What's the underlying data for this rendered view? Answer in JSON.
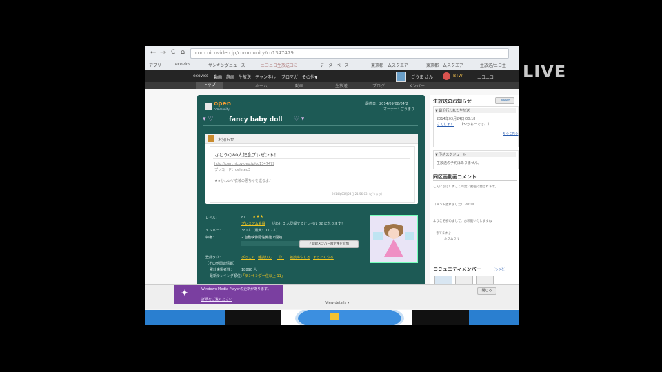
{
  "overlay": {
    "live_label": "LIVE"
  },
  "browser": {
    "nav_glyphs": {
      "back": "←",
      "forward": "→",
      "reload": "C",
      "home": "⌂"
    },
    "address_url": "com.nicovideo.jp/community/co1347479",
    "bookmarks": [
      "アプリ",
      "ecovics",
      "サンキングニュース",
      "ニコニコ生放送コミ",
      "データーベース",
      "東京都一ムスクエア",
      "東京都一ムスクエア",
      "生放送/ニコ生"
    ]
  },
  "site": {
    "top_nav": [
      "ecovics",
      "動画",
      "静画",
      "生放送",
      "チャンネル",
      "ブロマガ",
      "その他▼"
    ],
    "user_area": {
      "user": "ごうま さん",
      "badge": "BTW",
      "menu": "ニコニコ"
    },
    "tabs": [
      "トップ",
      "ホーム",
      "動画",
      "生放送",
      "ブログ",
      "メンバー"
    ]
  },
  "community": {
    "open_label": "open",
    "open_sub": "community",
    "header_right_1": "最終日：2014/09/08/04/2",
    "header_right_2": "オーナー：ごうまり",
    "title": "fancy baby doll",
    "notice": {
      "heading": "お知らせ",
      "title": "さとうの80人記念プレゼント！",
      "link": "http://com.nicovideo.jp/co1347479",
      "code": "プレコード：deleted3",
      "body": "★★かわいい衣装の思ちゃを送るよ♪",
      "date": "2014年03月24日 21:56:03（ごうまり）"
    },
    "info": {
      "level_label": "レベル：",
      "level_value": "81",
      "stars": "★★★",
      "premium": "プレミアム会員",
      "premium_note": "があと 3 人登録するとレベル 82 になります！",
      "members_label": "メンバー：",
      "members_value": "381人（最大: 1007人）",
      "privilege_label": "特権：",
      "privilege_value": "✓自動映像配信機能で開始",
      "member_button": "✓登録メンバー限定権を追加",
      "tags_label": "登録タグ：",
      "tags": [
        "ぴっこく",
        "雑談りん",
        "ゴリ",
        "雑談あやしる",
        "まったくやる"
      ],
      "other_label": "【その他関連情報】",
      "visits_label": "累計来場者数：",
      "visits_value": "18890 人",
      "rank_label": "最新ランキング順位：",
      "rank_value": "「ランキング一位以上 11」"
    }
  },
  "right_panel": {
    "notice_title": "生放送のお知らせ",
    "tweet": "Tweet",
    "recent_label": "▼ 最近行われた生放送",
    "recent_date": "2014年03月24日 00:18",
    "recent_link": "さてしま！",
    "recent_meta": "【やからーでは？】",
    "more": "もっと見る",
    "schedule_label": "▼ 予約スケジュール",
    "schedule_text": "生放送の予約はありません。",
    "comments_title": "同区画動画コメント",
    "comments": [
      "こんにちは！すごく可愛い動画で癒されます。",
      "コメント遅れました！ 20:14",
      "ようこそ初めまして、お邪魔いたしますね",
      "きてますよ",
      "ホフムラル"
    ],
    "members_title": "コミュニティメンバー",
    "members_more": "[もっと]"
  },
  "bottom": {
    "notification_text": "Windows Media Playerの更新があります。",
    "notification_link": "詳細をご覧ください",
    "dropdown": "View details ▾",
    "close": "閉じる"
  }
}
